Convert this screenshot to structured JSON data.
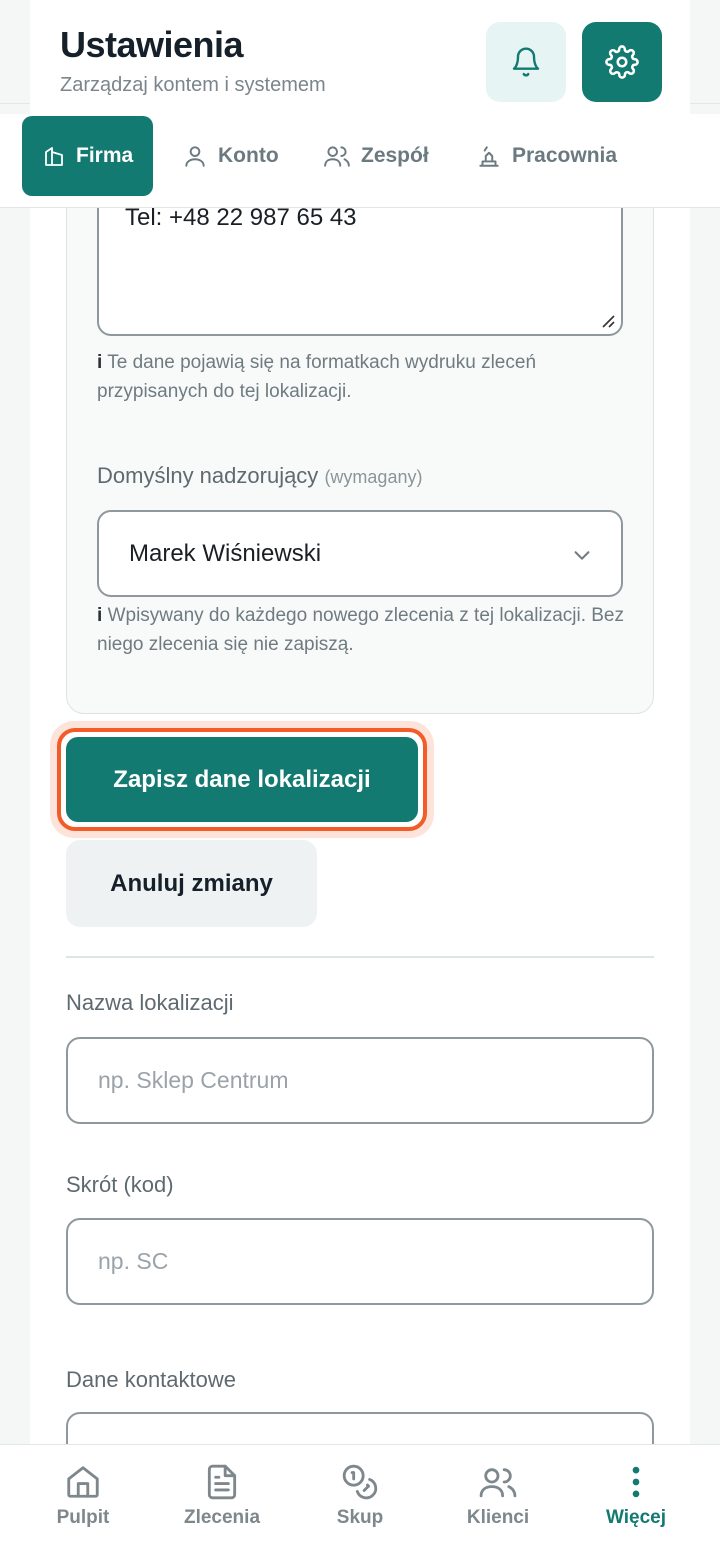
{
  "header": {
    "title": "Ustawienia",
    "subtitle": "Zarządzaj kontem i systemem",
    "bell_icon": "bell-icon",
    "gear_icon": "gear-icon"
  },
  "tabs": [
    {
      "label": "Firma",
      "icon": "building-icon",
      "active": true
    },
    {
      "label": "Konto",
      "icon": "user-icon",
      "active": false
    },
    {
      "label": "Zespół",
      "icon": "users-icon",
      "active": false
    },
    {
      "label": "Pracownia",
      "icon": "workshop-icon",
      "active": false
    }
  ],
  "location_form": {
    "contact_textarea_value": "Tel: +48 22 987 65 43",
    "contact_hint_marker": "i",
    "contact_hint": "Te dane pojawią się na formatkach wydruku zleceń przypisanych do tej lokalizacji.",
    "supervisor_label": "Domyślny nadzorujący",
    "supervisor_required": "(wymagany)",
    "supervisor_value": "Marek Wiśniewski",
    "supervisor_hint_marker": "i",
    "supervisor_hint": "Wpisywany do każdego nowego zlecenia z tej lokalizacji. Bez niego zlecenia się nie zapiszą.",
    "save_label": "Zapisz dane lokalizacji",
    "cancel_label": "Anuluj zmiany"
  },
  "new_location": {
    "name_label": "Nazwa lokalizacji",
    "name_placeholder": "np. Sklep Centrum",
    "code_label": "Skrót (kod)",
    "code_placeholder": "np. SC",
    "contact_label": "Dane kontaktowe"
  },
  "bottom_nav": [
    {
      "label": "Pulpit",
      "icon": "home-icon",
      "active": false
    },
    {
      "label": "Zlecenia",
      "icon": "document-icon",
      "active": false
    },
    {
      "label": "Skup",
      "icon": "coins-icon",
      "active": false
    },
    {
      "label": "Klienci",
      "icon": "users-icon",
      "active": false
    },
    {
      "label": "Więcej",
      "icon": "more-vertical-icon",
      "active": true
    }
  ],
  "colors": {
    "primary": "#137a72",
    "highlight": "#f25c28",
    "muted_bg": "#eef2f2"
  }
}
